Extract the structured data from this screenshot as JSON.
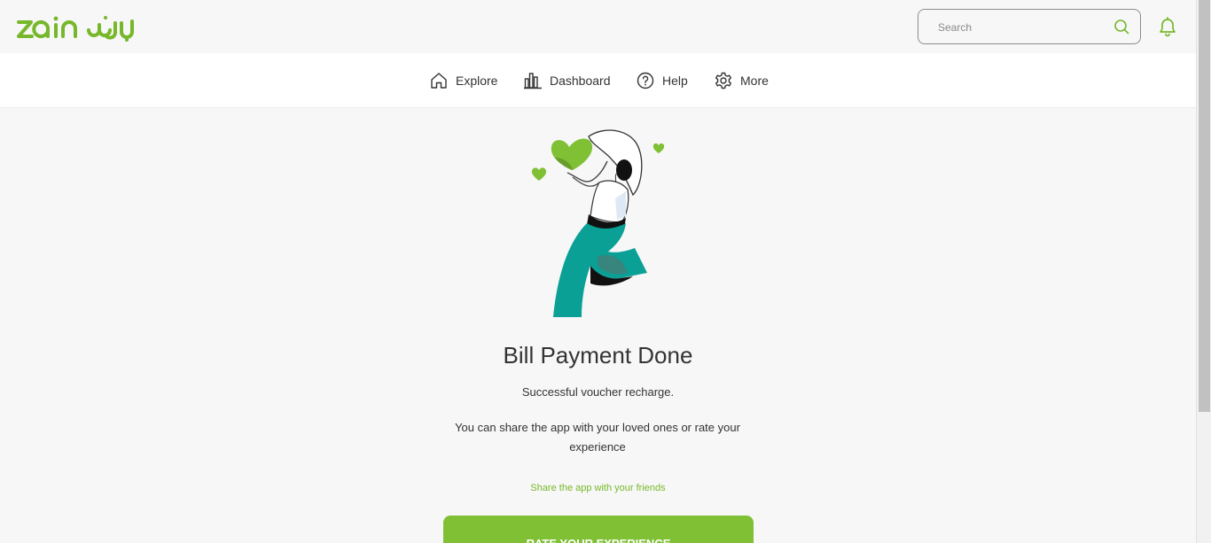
{
  "brand": {
    "logo_text": "zain زين",
    "accent_color": "#7fc035"
  },
  "header": {
    "search": {
      "placeholder": "Search",
      "value": ""
    },
    "icons": [
      "search-icon",
      "bell-icon"
    ]
  },
  "nav": {
    "items": [
      {
        "label": "Explore",
        "icon": "home-icon"
      },
      {
        "label": "Dashboard",
        "icon": "bar-chart-icon"
      },
      {
        "label": "Help",
        "icon": "question-icon"
      },
      {
        "label": "More",
        "icon": "gear-icon"
      }
    ]
  },
  "main": {
    "title": "Bill Payment Done",
    "subtitle": "Successful voucher recharge.",
    "message": "You can share the app with your loved ones or rate your experience",
    "share_link": "Share the app with your friends",
    "rate_button": "RATE YOUR EXPERIENCE"
  }
}
